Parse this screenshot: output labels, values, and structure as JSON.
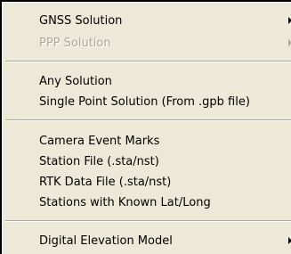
{
  "menu": {
    "groups": [
      {
        "items": [
          {
            "label": "GNSS Solution",
            "submenu": true,
            "disabled": false
          },
          {
            "label": "PPP Solution",
            "submenu": true,
            "disabled": true
          }
        ]
      },
      {
        "items": [
          {
            "label": "Any Solution",
            "submenu": false,
            "disabled": false
          },
          {
            "label": "Single Point Solution (From .gpb file)",
            "submenu": false,
            "disabled": false
          }
        ]
      },
      {
        "items": [
          {
            "label": "Camera Event Marks",
            "submenu": false,
            "disabled": false
          },
          {
            "label": "Station File (.sta/nst)",
            "submenu": false,
            "disabled": false
          },
          {
            "label": "RTK Data File (.sta/nst)",
            "submenu": false,
            "disabled": false
          },
          {
            "label": "Stations with Known Lat/Long",
            "submenu": false,
            "disabled": false
          }
        ]
      },
      {
        "items": [
          {
            "label": "Digital Elevation Model",
            "submenu": true,
            "disabled": false
          }
        ]
      }
    ]
  },
  "colors": {
    "menu_background": "#ece9d8",
    "disabled_text": "#aca899",
    "text": "#000000"
  }
}
